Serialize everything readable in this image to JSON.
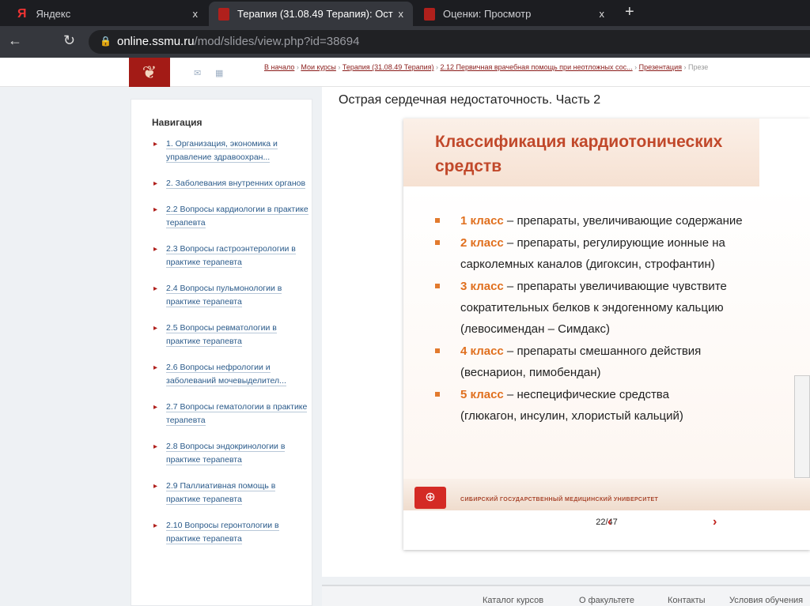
{
  "browser": {
    "tabs": [
      {
        "title": "Яндекс"
      },
      {
        "title": "Терапия (31.08.49 Терапия): Ост"
      },
      {
        "title": "Оценки: Просмотр"
      }
    ],
    "close": "x",
    "new_tab": "+",
    "url_domain": "online.ssmu.ru",
    "url_path": "/mod/slides/view.php?id=38694"
  },
  "breadcrumb": [
    "В начало",
    "Мои курсы",
    "Терапия (31.08.49 Терапия)",
    "2.12 Первичная врачебная помощь при неотложных сос...",
    "Презентация",
    "Презе"
  ],
  "sidebar": {
    "title": "Навигация",
    "items": [
      "1. Организация, экономика и управление здравоохран...",
      "2. Заболевания внутренних органов",
      "2.2 Вопросы кардиологии в практике терапевта",
      "2.3 Вопросы гастроэнтерологии в практике терапевта",
      "2.4 Вопросы пульмонологии в практике терапевта",
      "2.5 Вопросы ревматологии в практике терапевта",
      "2.6 Вопросы нефрологии и заболеваний мочевыделител...",
      "2.7 Вопросы гематологии в практике терапевта",
      "2.8 Вопросы эндокринологии в практике терапевта",
      "2.9 Паллиативная помощь в практике терапевта",
      "2.10 Вопросы геронтологии в практике терапевта"
    ]
  },
  "main": {
    "title": "Острая сердечная недостаточность. Часть 2"
  },
  "slide": {
    "heading": "Классификация кардиотонических средств",
    "items": [
      {
        "cls": "1 класс",
        "text": " – препараты, увеличивающие содержание",
        "extra": ""
      },
      {
        "cls": "2 класс",
        "text": " – препараты, регулирующие ионные на",
        "extra": "сарколемных каналов (дигоксин, строфантин)"
      },
      {
        "cls": "3 класс",
        "text": " – препараты увеличивающие чувствите",
        "extra": "сократительных белков к эндогенному кальцию (левосимендан – Симдакс)"
      },
      {
        "cls": "4 класс",
        "text": " – препараты смешанного действия",
        "extra": "(веснарион, пимобендан)"
      },
      {
        "cls": "5 класс",
        "text": " – неспецифические  средства",
        "extra": "(глюкагон, инсулин, хлористый кальций)"
      }
    ],
    "university": "СИБИРСКИЙ ГОСУДАРСТВЕННЫЙ МЕДИЦИНСКИЙ УНИВЕРСИТЕТ",
    "page": "22/47",
    "prev": "‹",
    "next": "›"
  },
  "footer": [
    "Каталог курсов",
    "О факультете",
    "Контакты",
    "Условия обучения"
  ]
}
